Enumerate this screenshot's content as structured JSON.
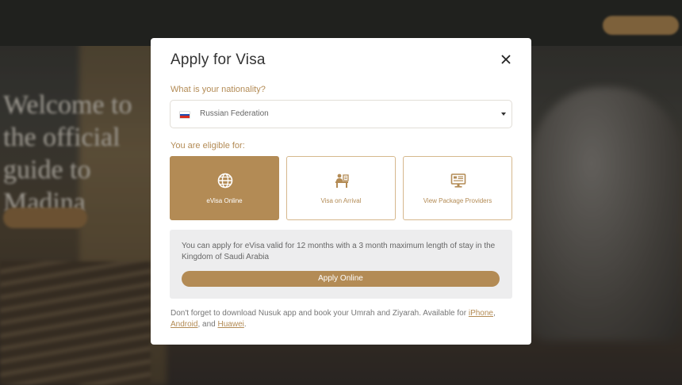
{
  "modal": {
    "title": "Apply for Visa",
    "close_icon": "close-icon",
    "nationality_label": "What is your nationality?",
    "nationality_value": "Russian Federation",
    "eligible_label": "You are eligible for:",
    "options": [
      {
        "label": "eVisa Online",
        "icon": "globe-icon",
        "selected": true
      },
      {
        "label": "Visa on Arrival",
        "icon": "officer-desk-icon",
        "selected": false
      },
      {
        "label": "View Package Providers",
        "icon": "monitor-icon",
        "selected": false
      }
    ],
    "info_text": "You can apply for eVisa valid for 12 months with a 3 month maximum length of stay in the Kingdom of Saudi Arabia",
    "apply_button": "Apply Online",
    "footer_text": "Don't forget to download Nusuk app and book your Umrah and Ziyarah. Available for",
    "footer_links": [
      "iPhone",
      "Android",
      "Huawei"
    ],
    "footer_sep1": ", ",
    "footer_sep2": ", and ",
    "footer_end": "."
  },
  "background": {
    "hero_title": "Welcome to the official guide to Madina"
  },
  "colors": {
    "accent": "#b38b55",
    "info_bg": "#ededee"
  }
}
